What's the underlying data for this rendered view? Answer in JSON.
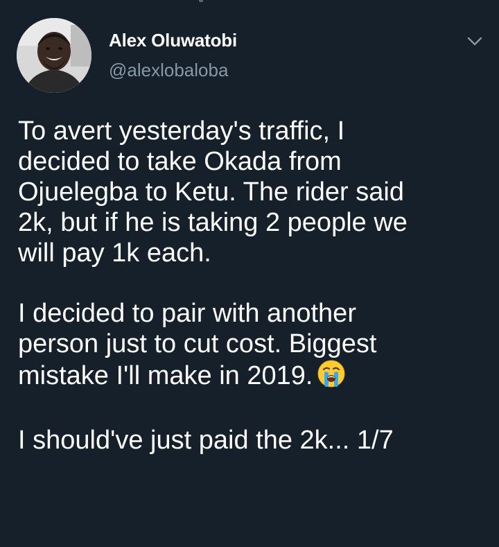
{
  "author": {
    "display_name": "Alex Oluwatobi",
    "handle": "@alexlobaloba"
  },
  "icons": {
    "menu": "chevron-down-icon",
    "emoji": "loudly-crying-face-emoji"
  },
  "tweet": {
    "paragraph_1": "To avert yesterday's traffic, I\ndecided to take Okada from\nOjuelegba to Ketu. The rider said\n2k, but if he is taking 2 people we\nwill pay 1k each.",
    "paragraph_2": "I decided to pair with another\nperson just to cut cost. Biggest\nmistake I'll make in 2019.",
    "paragraph_3": "I should've just paid the 2k... 1/7"
  },
  "colors": {
    "background": "#15202b",
    "text": "#ffffff",
    "secondary_text": "#8899a6"
  }
}
